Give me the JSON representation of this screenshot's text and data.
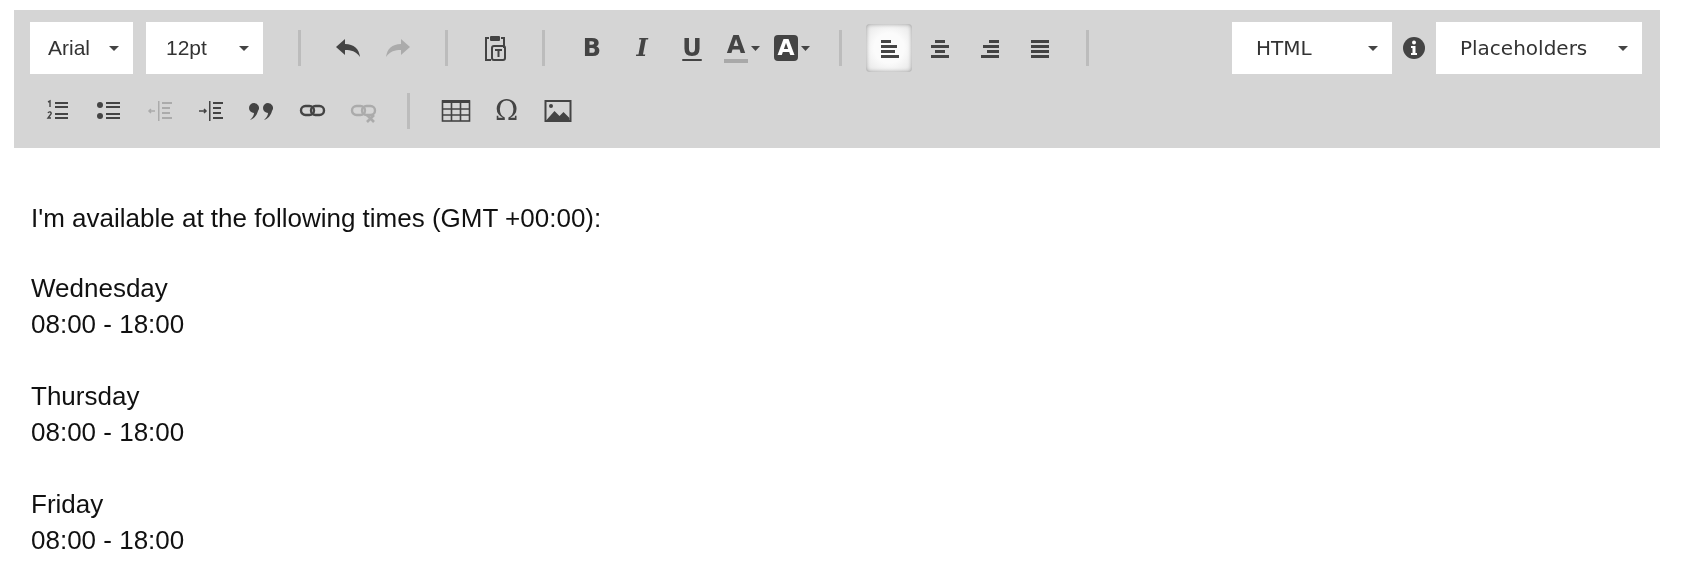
{
  "toolbar": {
    "row_1": [
      {
        "kind": "dropdown",
        "value": "Arial"
      },
      {
        "kind": "dropdown",
        "value": "12pt"
      },
      {
        "kind": "separator"
      },
      {
        "kind": "undo",
        "disabled": false
      },
      {
        "kind": "redo",
        "disabled": true
      },
      {
        "kind": "separator"
      },
      {
        "kind": "paste",
        "disabled": false
      },
      {
        "kind": "separator"
      },
      {
        "kind": "bold",
        "label": "B",
        "disabled": false
      },
      {
        "kind": "italic",
        "label": "I",
        "disabled": false
      },
      {
        "kind": "underline",
        "label": "U",
        "disabled": false
      },
      {
        "kind": "textcolor",
        "label": "A",
        "disabled": false
      },
      {
        "kind": "backcolor",
        "label": "A",
        "disabled": false
      },
      {
        "kind": "separator"
      },
      {
        "kind": "alignleft",
        "disabled": false,
        "selected": true
      },
      {
        "kind": "aligncenter",
        "disabled": false,
        "selected": false
      },
      {
        "kind": "alignright",
        "disabled": false,
        "selected": false
      },
      {
        "kind": "alignjustify",
        "disabled": false,
        "selected": false
      },
      {
        "kind": "separator"
      }
    ],
    "right": [
      {
        "kind": "dropdown",
        "value": "HTML"
      },
      {
        "kind": "info",
        "disabled": false
      },
      {
        "kind": "dropdown",
        "value": "Placeholders"
      }
    ],
    "row_2": [
      {
        "kind": "orderedlist",
        "disabled": false
      },
      {
        "kind": "bulletlist",
        "disabled": false
      },
      {
        "kind": "outdent",
        "disabled": true
      },
      {
        "kind": "indent",
        "disabled": false
      },
      {
        "kind": "blockquote",
        "disabled": false
      },
      {
        "kind": "link",
        "disabled": false
      },
      {
        "kind": "unlink",
        "disabled": true
      },
      {
        "kind": "separator"
      },
      {
        "kind": "table",
        "disabled": false
      },
      {
        "kind": "charmap",
        "label": "Ω",
        "disabled": false
      },
      {
        "kind": "image",
        "disabled": false
      }
    ]
  },
  "document": {
    "intro": "I'm available at the following times (GMT +00:00):",
    "schedule": [
      {
        "day": "Wednesday",
        "hours": "08:00 - 18:00"
      },
      {
        "day": "Thursday",
        "hours": "08:00 - 18:00"
      },
      {
        "day": "Friday",
        "hours": "08:00 - 18:00"
      }
    ]
  }
}
